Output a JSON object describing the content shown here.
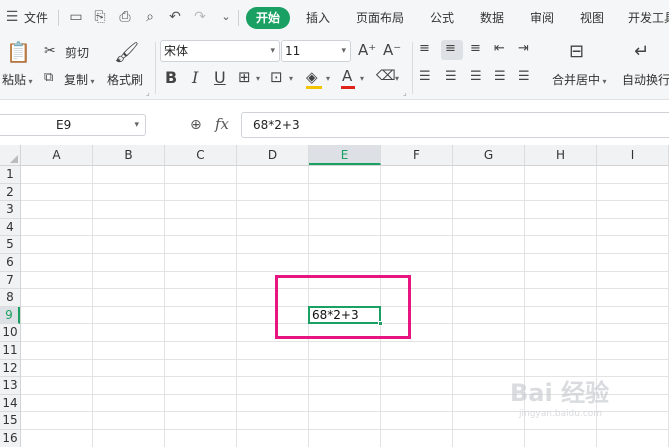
{
  "menubar": {
    "file_label": "文件",
    "tabs": [
      "开始",
      "插入",
      "页面布局",
      "公式",
      "数据",
      "审阅",
      "视图",
      "开发工具"
    ],
    "active_tab": "开始"
  },
  "ribbon": {
    "cut_label": "剪切",
    "paste_label": "粘贴",
    "copy_label": "复制",
    "format_painter_label": "格式刷",
    "font_name": "宋体",
    "font_size": "11",
    "merge_center_label": "合并居中",
    "wrap_text_label": "自动换行"
  },
  "formula_bar": {
    "cell_ref": "E9",
    "fx": "fx",
    "formula": "68*2+3"
  },
  "sheet": {
    "columns": [
      "A",
      "B",
      "C",
      "D",
      "E",
      "F",
      "G",
      "H",
      "I"
    ],
    "rows": [
      "1",
      "2",
      "3",
      "4",
      "5",
      "6",
      "7",
      "8",
      "9",
      "10",
      "11",
      "12",
      "13",
      "14",
      "15",
      "16"
    ],
    "selected_column": "E",
    "selected_row": "9",
    "active_cell_value": "68*2+3"
  },
  "watermark": {
    "text": "Bai 经验",
    "sub": "jingyan.baidu.com"
  },
  "colors": {
    "accent": "#1aa063",
    "highlight": "#e6157f"
  }
}
